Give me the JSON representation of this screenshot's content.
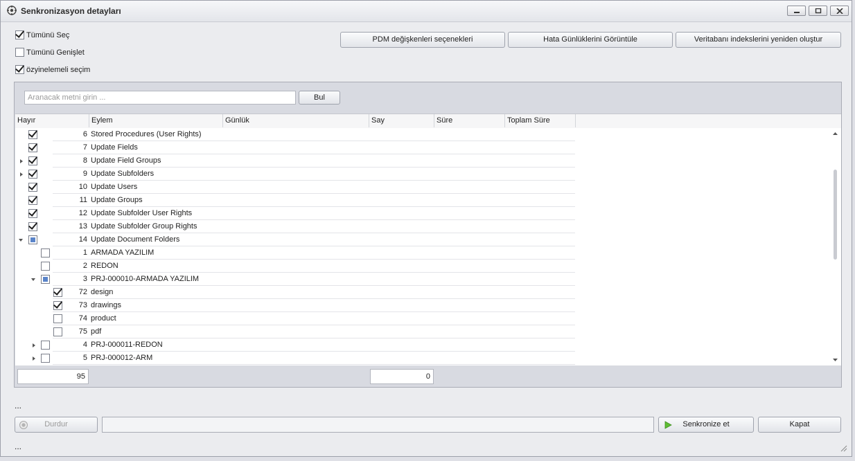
{
  "window": {
    "title": "Senkronizasyon detayları",
    "icon": "sync-settings-icon"
  },
  "options": {
    "select_all": {
      "label": "Tümünü Seç",
      "checked": true
    },
    "expand_all": {
      "label": "Tümünü Genişlet",
      "checked": false
    },
    "recursive": {
      "label": "özyinelemeli seçim",
      "checked": true
    }
  },
  "toolbar": {
    "pdm_vars": "PDM değişkenleri seçenekleri",
    "error_logs": "Hata Günlüklerini Görüntüle",
    "rebuild_index": "Veritabanı indekslerini yeniden oluştur"
  },
  "search": {
    "placeholder": "Aranacak metni girin ...",
    "button": "Bul"
  },
  "grid": {
    "columns": [
      "Hayır",
      "Eylem",
      "Günlük",
      "Say",
      "Süre",
      "Toplam Süre"
    ],
    "rows": [
      {
        "level": 0,
        "expander": "none",
        "check": "checked",
        "no": "6",
        "action": "Stored Procedures (User Rights)"
      },
      {
        "level": 0,
        "expander": "none",
        "check": "checked",
        "no": "7",
        "action": "Update Fields"
      },
      {
        "level": 0,
        "expander": "right",
        "check": "checked",
        "no": "8",
        "action": "Update Field Groups"
      },
      {
        "level": 0,
        "expander": "right",
        "check": "checked",
        "no": "9",
        "action": "Update Subfolders"
      },
      {
        "level": 0,
        "expander": "none",
        "check": "checked",
        "no": "10",
        "action": "Update Users"
      },
      {
        "level": 0,
        "expander": "none",
        "check": "checked",
        "no": "11",
        "action": "Update Groups"
      },
      {
        "level": 0,
        "expander": "none",
        "check": "checked",
        "no": "12",
        "action": "Update Subfolder User Rights"
      },
      {
        "level": 0,
        "expander": "none",
        "check": "checked",
        "no": "13",
        "action": "Update Subfolder Group Rights"
      },
      {
        "level": 0,
        "expander": "down",
        "check": "partial",
        "no": "14",
        "action": "Update Document Folders"
      },
      {
        "level": 1,
        "expander": "none",
        "check": "unchecked",
        "no": "1",
        "action": "ARMADA YAZILIM"
      },
      {
        "level": 1,
        "expander": "none",
        "check": "unchecked",
        "no": "2",
        "action": "REDON"
      },
      {
        "level": 1,
        "expander": "down",
        "check": "partial",
        "no": "3",
        "action": "PRJ-000010-ARMADA YAZILIM"
      },
      {
        "level": 2,
        "expander": "none",
        "check": "checked",
        "no": "72",
        "action": "design"
      },
      {
        "level": 2,
        "expander": "none",
        "check": "checked",
        "no": "73",
        "action": "drawings"
      },
      {
        "level": 2,
        "expander": "none",
        "check": "unchecked",
        "no": "74",
        "action": "product"
      },
      {
        "level": 2,
        "expander": "none",
        "check": "unchecked",
        "no": "75",
        "action": "pdf"
      },
      {
        "level": 1,
        "expander": "right",
        "check": "unchecked",
        "no": "4",
        "action": "PRJ-000011-REDON"
      },
      {
        "level": 1,
        "expander": "right",
        "check": "unchecked",
        "no": "5",
        "action": "PRJ-000012-ARM"
      }
    ],
    "totals": {
      "count": "95",
      "count_sum": "0"
    }
  },
  "status": {
    "line1": "...",
    "line2": "..."
  },
  "actions": {
    "stop": "Durdur",
    "sync": "Senkronize et",
    "close": "Kapat"
  }
}
